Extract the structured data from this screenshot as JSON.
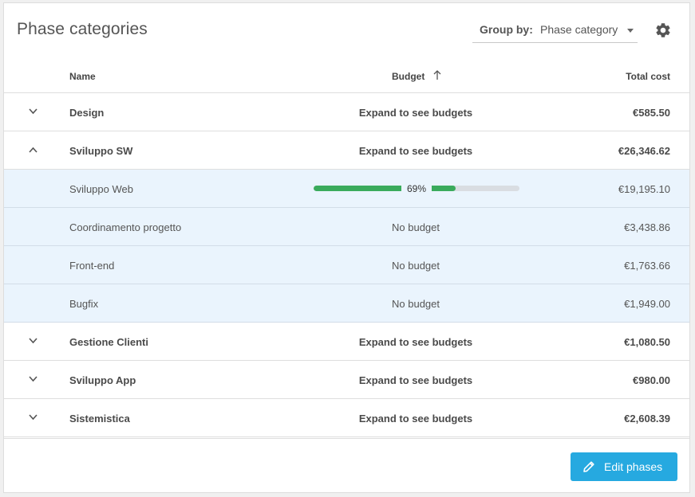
{
  "header": {
    "title": "Phase categories",
    "group_by_label": "Group by:",
    "group_by_value": "Phase category"
  },
  "table": {
    "columns": {
      "name": "Name",
      "budget": "Budget",
      "total_cost": "Total cost"
    },
    "rows": [
      {
        "type": "group",
        "expanded": false,
        "name": "Design",
        "budget": "Expand to see budgets",
        "cost": "€585.50"
      },
      {
        "type": "group",
        "expanded": true,
        "name": "Sviluppo SW",
        "budget": "Expand to see budgets",
        "cost": "€26,346.62"
      },
      {
        "type": "child",
        "name": "Sviluppo Web",
        "budget_progress": 0.69,
        "budget_label": "69%",
        "cost": "€19,195.10"
      },
      {
        "type": "child",
        "name": "Coordinamento progetto",
        "budget": "No budget",
        "cost": "€3,438.86"
      },
      {
        "type": "child",
        "name": "Front-end",
        "budget": "No budget",
        "cost": "€1,763.66"
      },
      {
        "type": "child",
        "name": "Bugfix",
        "budget": "No budget",
        "cost": "€1,949.00"
      },
      {
        "type": "group",
        "expanded": false,
        "name": "Gestione Clienti",
        "budget": "Expand to see budgets",
        "cost": "€1,080.50"
      },
      {
        "type": "group",
        "expanded": false,
        "name": "Sviluppo App",
        "budget": "Expand to see budgets",
        "cost": "€980.00"
      },
      {
        "type": "group",
        "expanded": false,
        "name": "Sistemistica",
        "budget": "Expand to see budgets",
        "cost": "€2,608.39"
      }
    ]
  },
  "footer": {
    "edit_button_label": "Edit phases"
  },
  "colors": {
    "accent": "#26a9e0",
    "progress": "#3aab5c",
    "child_row_bg": "#eaf4fd"
  },
  "icons": {
    "settings": "gear-icon",
    "sort": "arrow-up-icon",
    "edit": "pencil-icon",
    "expand": "chevron-down-icon",
    "collapse": "chevron-up-icon"
  }
}
